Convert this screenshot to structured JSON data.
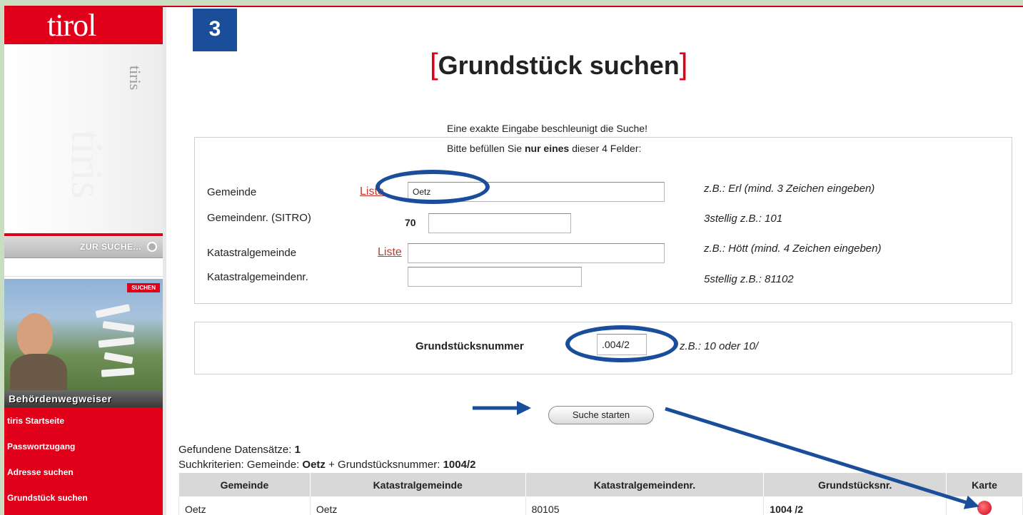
{
  "sidebar": {
    "logo": "tirol",
    "brand_small": "tiris",
    "brand_big": "tiris",
    "zur_suche": "ZUR SUCHE...",
    "promo_tag": "SUCHEN",
    "promo_label": "Behördenwegweiser",
    "nav": [
      {
        "label": "tiris Startseite"
      },
      {
        "label": "Passwortzugang"
      },
      {
        "label": "Adresse suchen"
      },
      {
        "label": "Grundstück suchen"
      }
    ]
  },
  "step_badge": "3",
  "page": {
    "title_open": "[",
    "title": "Grundstück suchen",
    "title_close": "]",
    "hint_exact": "Eine exakte Eingabe beschleunigt die Suche!",
    "hint_fill_a": "Bitte befüllen Sie ",
    "hint_fill_b": "nur eines",
    "hint_fill_c": " dieser 4 Felder:"
  },
  "form": {
    "gemeinde": {
      "label": "Gemeinde",
      "liste": "Liste",
      "value": "Oetz",
      "example": "z.B.: Erl (mind. 3 Zeichen eingeben)"
    },
    "gemeindenr": {
      "label": "Gemeindenr. (SITRO)",
      "prefix": "70",
      "value": "",
      "example": "3stellig z.B.: 101"
    },
    "katastral": {
      "label": "Katastralgemeinde",
      "liste": "Liste",
      "value": "",
      "example": "z.B.: Hött (mind. 4 Zeichen eingeben)"
    },
    "katastralnr": {
      "label": "Katastralgemeindenr.",
      "value": "",
      "example": "5stellig z.B.: 81102"
    },
    "grundstueck": {
      "label": "Grundstücksnummer",
      "value": ".004/2",
      "example": "z.B.: 10 oder 10/"
    }
  },
  "search_button": "Suche starten",
  "results": {
    "count_label": "Gefundene Datensätze: ",
    "count": "1",
    "criteria_label": "Suchkriterien:  Gemeinde: ",
    "criteria_gemeinde": "Oetz",
    "criteria_mid": " + Grundstücksnummer: ",
    "criteria_nr": "1004/2",
    "columns": [
      "Gemeinde",
      "Katastralgemeinde",
      "Katastralgemeindenr.",
      "Grundstücksnr.",
      "Karte"
    ],
    "rows": [
      {
        "gemeinde": "Oetz",
        "katastral": "Oetz",
        "katastralnr": "80105",
        "nr": "1004 /2"
      }
    ]
  },
  "colors": {
    "accent_red": "#e0001a",
    "annotation_blue": "#1a4e9b"
  }
}
